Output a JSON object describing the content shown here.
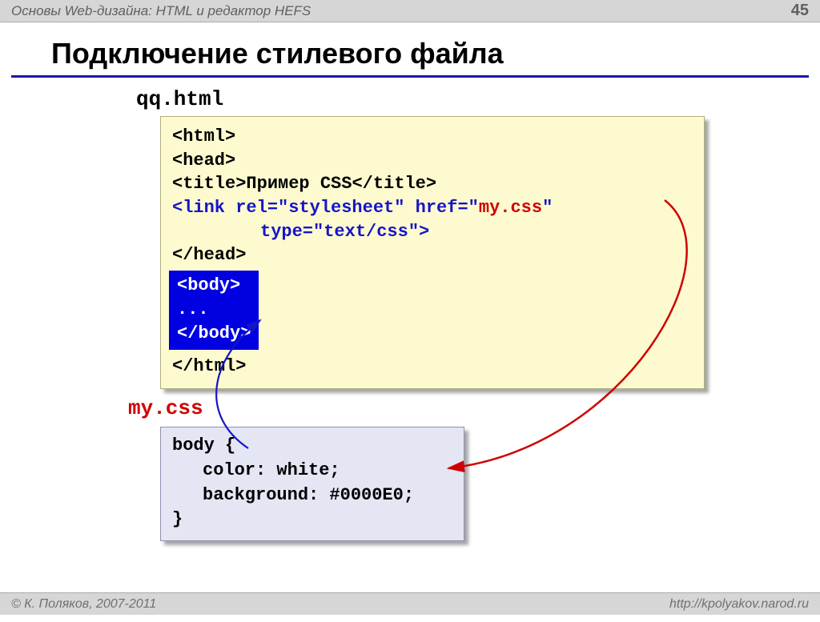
{
  "header": {
    "breadcrumb": "Основы Web-дизайна: HTML и редактор HEFS",
    "page_number": "45"
  },
  "title": "Подключение стилевого файла",
  "file1": {
    "name": "qq.html",
    "code": {
      "l1": "<html>",
      "l2": "<head>",
      "l3a": "<title>",
      "l3b": "Пример CSS",
      "l3c": "</title>",
      "l4a": "<link rel=\"stylesheet\" href=\"",
      "l4b": "my.css",
      "l4c": "\"",
      "l5": "type=\"text/css\">",
      "l6": "</head>",
      "body_open": "<body>",
      "body_dots": "...",
      "body_close": "</body>",
      "l8": "</html>"
    }
  },
  "file2": {
    "name": "my.css",
    "code": {
      "l1": "body {",
      "l2": "color: white;",
      "l3": "background: #0000E0;",
      "l4": "}"
    }
  },
  "footer": {
    "copyright": "© К. Поляков, 2007-2011",
    "url": "http://kpolyakov.narod.ru"
  }
}
